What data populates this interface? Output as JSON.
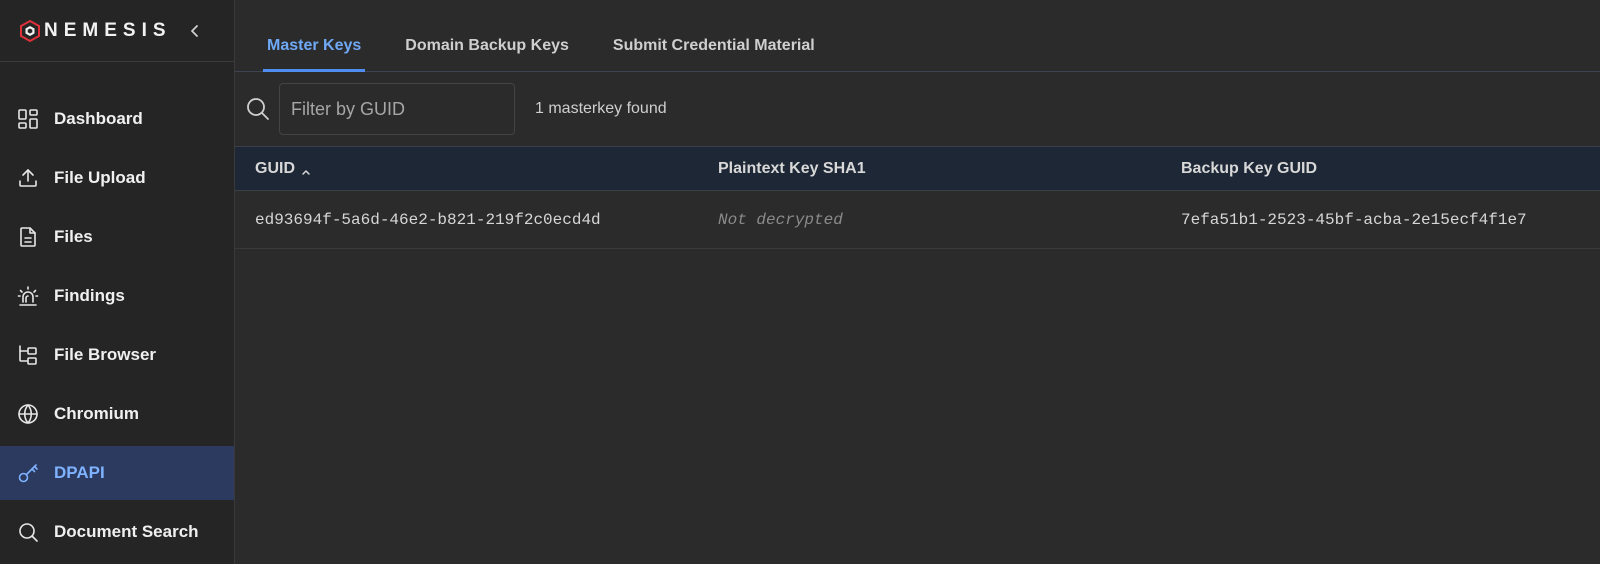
{
  "brand": {
    "name": "NEMESIS",
    "accent": "#e0303a"
  },
  "sidebar": {
    "items": [
      {
        "label": "Dashboard",
        "icon": "dashboard-icon"
      },
      {
        "label": "File Upload",
        "icon": "upload-icon"
      },
      {
        "label": "Files",
        "icon": "file-icon"
      },
      {
        "label": "Findings",
        "icon": "siren-icon"
      },
      {
        "label": "File Browser",
        "icon": "folder-tree-icon"
      },
      {
        "label": "Chromium",
        "icon": "globe-icon"
      },
      {
        "label": "DPAPI",
        "icon": "key-icon",
        "active": true
      },
      {
        "label": "Document Search",
        "icon": "search-icon"
      }
    ]
  },
  "tabs": [
    {
      "label": "Master Keys",
      "active": true
    },
    {
      "label": "Domain Backup Keys"
    },
    {
      "label": "Submit Credential Material"
    }
  ],
  "filter": {
    "placeholder": "Filter by GUID",
    "value": "",
    "count_text": "1 masterkey found"
  },
  "table": {
    "columns": [
      "GUID",
      "Plaintext Key SHA1",
      "Backup Key GUID"
    ],
    "sort": {
      "column": "GUID",
      "direction": "asc"
    },
    "rows": [
      {
        "guid": "ed93694f-5a6d-46e2-b821-219f2c0ecd4d",
        "sha1": "Not decrypted",
        "backup_guid": "7efa51b1-2523-45bf-acba-2e15ecf4f1e7"
      }
    ]
  },
  "colors": {
    "active_accent": "#6fa8f5",
    "active_nav_bg": "#2b3a5e",
    "table_header_bg": "#1d2735"
  }
}
